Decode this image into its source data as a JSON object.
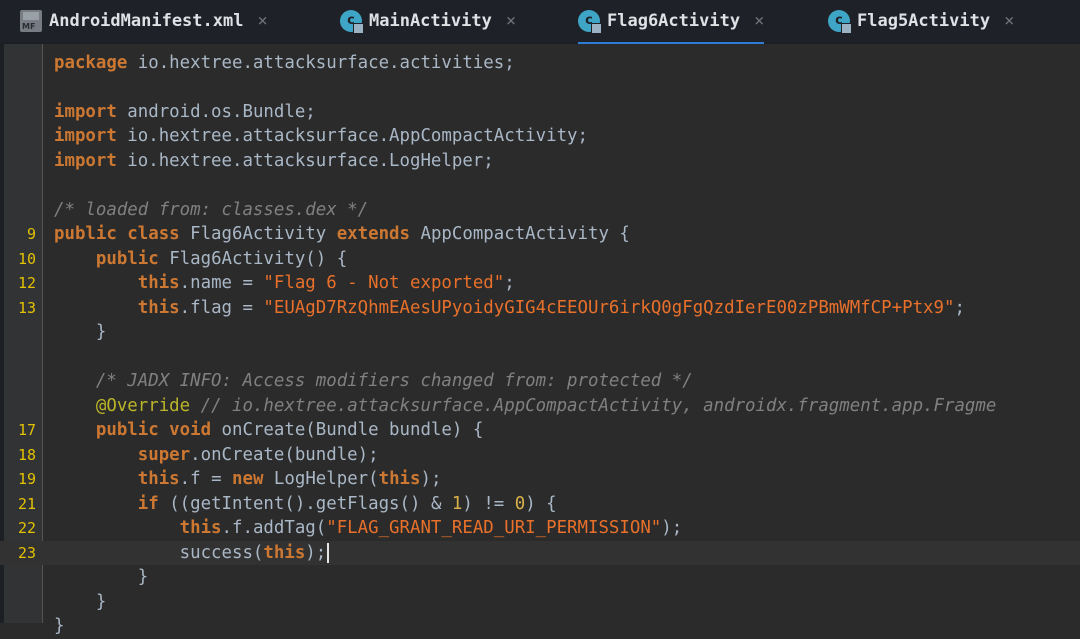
{
  "tabs": [
    {
      "label": "AndroidManifest.xml",
      "icon": "manifest-file-icon",
      "active": false
    },
    {
      "label": "MainActivity",
      "icon": "class-icon",
      "active": false
    },
    {
      "label": "Flag6Activity",
      "icon": "class-icon",
      "active": true
    },
    {
      "label": "Flag5Activity",
      "icon": "class-icon",
      "active": false
    }
  ],
  "tab_close_glyph": "×",
  "icon_text": {
    "manifest": "MF",
    "class": "c"
  },
  "colors": {
    "keyword": "#cc7832",
    "string": "#e8702a",
    "comment": "#808080",
    "active_tab_underline": "#2f7cd6",
    "line_number": "#e4c100"
  },
  "editor": {
    "lines": [
      {
        "ln": "",
        "tokens": [
          [
            "kw",
            "package"
          ],
          [
            "p",
            " io.hextree.attacksurface.activities;"
          ]
        ]
      },
      {
        "ln": "",
        "tokens": []
      },
      {
        "ln": "",
        "tokens": [
          [
            "kw",
            "import"
          ],
          [
            "p",
            " android.os.Bundle;"
          ]
        ]
      },
      {
        "ln": "",
        "tokens": [
          [
            "kw",
            "import"
          ],
          [
            "p",
            " io.hextree.attacksurface.AppCompactActivity;"
          ]
        ]
      },
      {
        "ln": "",
        "tokens": [
          [
            "kw",
            "import"
          ],
          [
            "p",
            " io.hextree.attacksurface.LogHelper;"
          ]
        ]
      },
      {
        "ln": "",
        "tokens": []
      },
      {
        "ln": "",
        "tokens": [
          [
            "cm",
            "/* loaded from: classes.dex */"
          ]
        ]
      },
      {
        "ln": "9",
        "tokens": [
          [
            "kw",
            "public class"
          ],
          [
            "p",
            " Flag6Activity "
          ],
          [
            "kw",
            "extends"
          ],
          [
            "p",
            " AppCompactActivity {"
          ]
        ]
      },
      {
        "ln": "10",
        "tokens": [
          [
            "p",
            "    "
          ],
          [
            "kw",
            "public"
          ],
          [
            "p",
            " Flag6Activity() {"
          ]
        ]
      },
      {
        "ln": "12",
        "tokens": [
          [
            "p",
            "        "
          ],
          [
            "kw",
            "this"
          ],
          [
            "p",
            ".name = "
          ],
          [
            "str",
            "\"Flag 6 - Not exported\""
          ],
          [
            "p",
            ";"
          ]
        ]
      },
      {
        "ln": "13",
        "tokens": [
          [
            "p",
            "        "
          ],
          [
            "kw",
            "this"
          ],
          [
            "p",
            ".flag = "
          ],
          [
            "str",
            "\"EUAgD7RzQhmEAesUPyoidyGIG4cEEOUr6irkQ0gFgQzdIerE00zPBmWMfCP+Ptx9\""
          ],
          [
            "p",
            ";"
          ]
        ]
      },
      {
        "ln": "",
        "tokens": [
          [
            "p",
            "    }"
          ]
        ]
      },
      {
        "ln": "",
        "tokens": []
      },
      {
        "ln": "",
        "tokens": [
          [
            "p",
            "    "
          ],
          [
            "cm",
            "/* JADX INFO: Access modifiers changed from: protected */"
          ]
        ]
      },
      {
        "ln": "",
        "tokens": [
          [
            "p",
            "    "
          ],
          [
            "ann",
            "@Override"
          ],
          [
            "p",
            " "
          ],
          [
            "cm",
            "// io.hextree.attacksurface.AppCompactActivity, androidx.fragment.app.Fragme"
          ]
        ]
      },
      {
        "ln": "17",
        "tokens": [
          [
            "p",
            "    "
          ],
          [
            "kw",
            "public void"
          ],
          [
            "p",
            " onCreate(Bundle bundle) {"
          ]
        ]
      },
      {
        "ln": "18",
        "tokens": [
          [
            "p",
            "        "
          ],
          [
            "kw",
            "super"
          ],
          [
            "p",
            ".onCreate(bundle);"
          ]
        ]
      },
      {
        "ln": "19",
        "tokens": [
          [
            "p",
            "        "
          ],
          [
            "kw",
            "this"
          ],
          [
            "p",
            ".f = "
          ],
          [
            "kw",
            "new"
          ],
          [
            "p",
            " LogHelper("
          ],
          [
            "kw",
            "this"
          ],
          [
            "p",
            ");"
          ]
        ]
      },
      {
        "ln": "21",
        "tokens": [
          [
            "p",
            "        "
          ],
          [
            "kw",
            "if"
          ],
          [
            "p",
            " ((getIntent().getFlags() & "
          ],
          [
            "num",
            "1"
          ],
          [
            "p",
            ") != "
          ],
          [
            "num",
            "0"
          ],
          [
            "p",
            ") {"
          ]
        ]
      },
      {
        "ln": "22",
        "tokens": [
          [
            "p",
            "            "
          ],
          [
            "kw",
            "this"
          ],
          [
            "p",
            ".f.addTag("
          ],
          [
            "str",
            "\"FLAG_GRANT_READ_URI_PERMISSION\""
          ],
          [
            "p",
            ");"
          ]
        ]
      },
      {
        "ln": "23",
        "current": true,
        "tokens": [
          [
            "p",
            "            success("
          ],
          [
            "kw",
            "this"
          ],
          [
            "p",
            ");"
          ]
        ]
      },
      {
        "ln": "",
        "tokens": [
          [
            "p",
            "        }"
          ]
        ]
      },
      {
        "ln": "",
        "tokens": [
          [
            "p",
            "    }"
          ]
        ]
      },
      {
        "ln": "",
        "tokens": [
          [
            "p",
            "}"
          ]
        ]
      }
    ]
  }
}
